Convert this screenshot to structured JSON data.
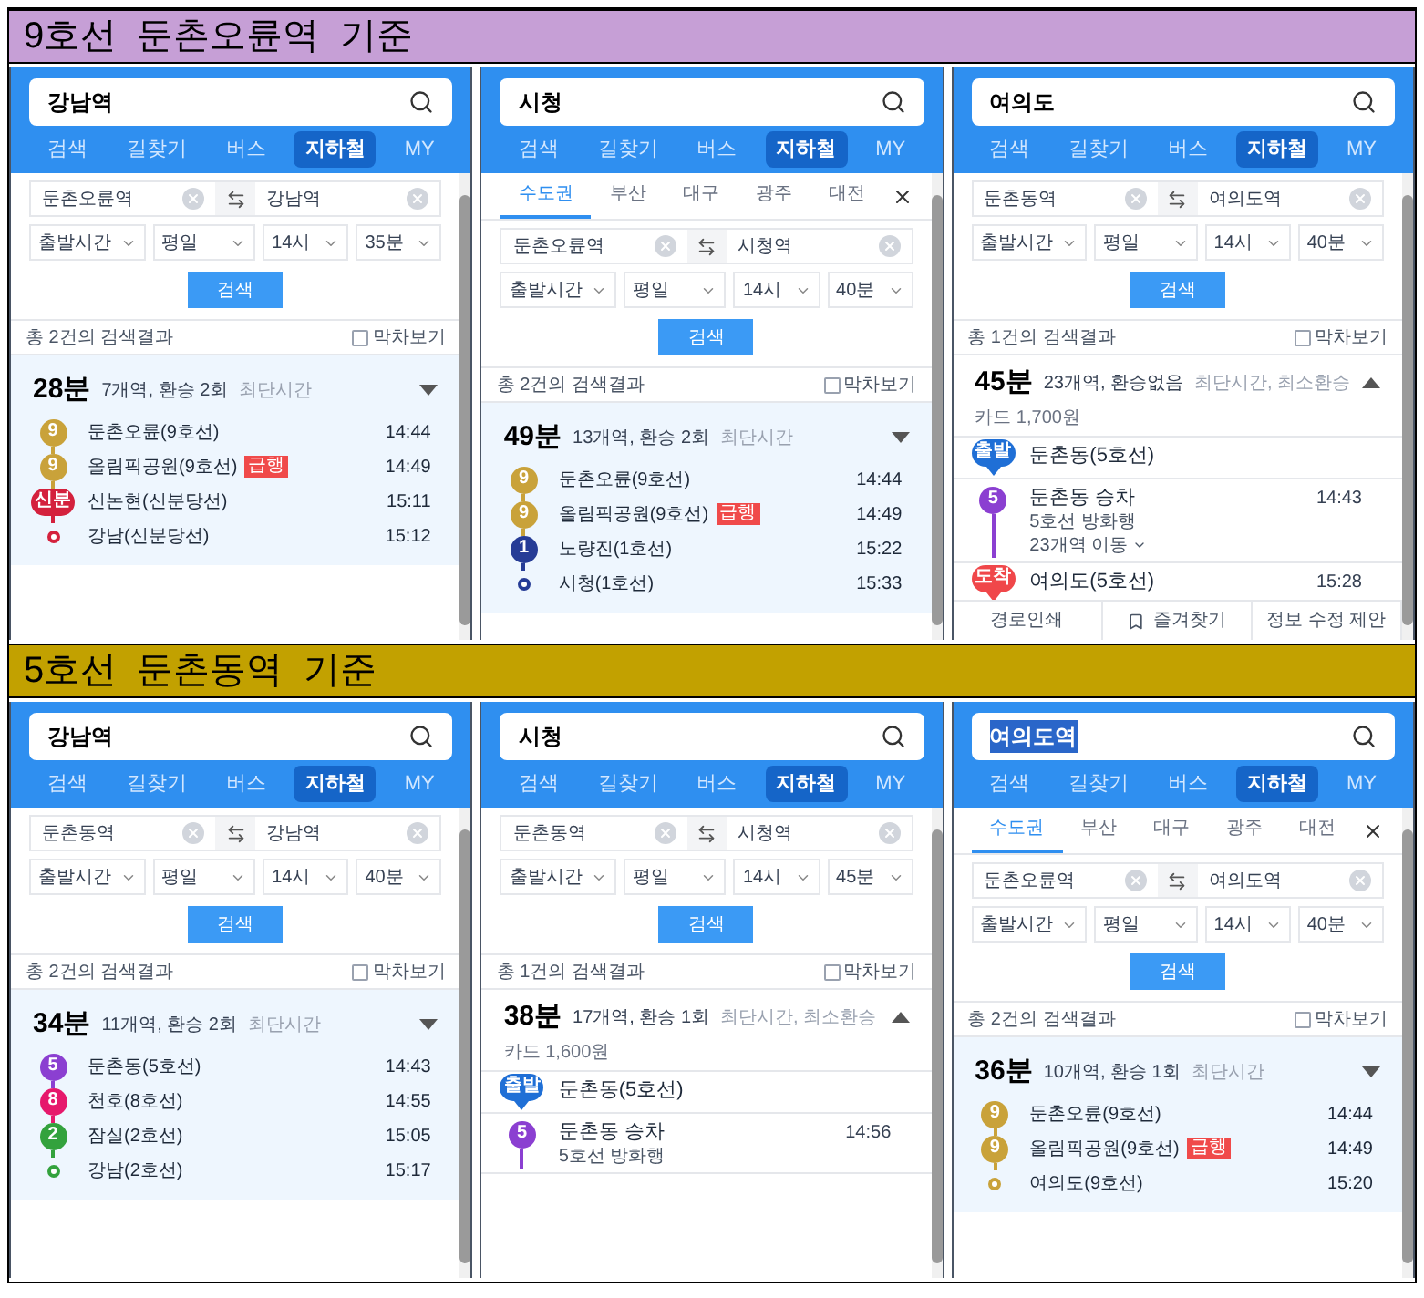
{
  "sections": [
    {
      "title": "9호선  둔촌오륜역  기준",
      "color": "#c69fd6",
      "panels": [
        {
          "query": "강남역",
          "query_highlighted": false,
          "nav_tabs": [
            {
              "label": "검색",
              "selected": false
            },
            {
              "label": "길찾기",
              "selected": false
            },
            {
              "label": "버스",
              "selected": false
            },
            {
              "label": "지하철",
              "selected": true
            },
            {
              "label": "MY",
              "selected": false
            }
          ],
          "from": "둔촌오륜역",
          "to": "강남역",
          "selects": [
            "출발시간",
            "평일",
            "14시",
            "35분"
          ],
          "search_button": "검색",
          "result_count": "총 2건의 검색결과",
          "last_train": {
            "label": "막차보기",
            "checked": false
          },
          "route": {
            "kind": "compact",
            "duration": "28분",
            "summary": "7개역, 환승 2회",
            "tags": "최단시간",
            "expanded": false,
            "stops": [
              {
                "kind": "station",
                "badge": "9",
                "color": "#c9a23a",
                "name": "둔촌오륜(9호선)",
                "time": "14:44"
              },
              {
                "kind": "station",
                "badge": "9",
                "color": "#c9a23a",
                "name": "올림픽공원(9호선)",
                "express": "급행",
                "time": "14:49"
              },
              {
                "kind": "station",
                "badge": "신분",
                "color": "#d4213d",
                "name": "신논현(신분당선)",
                "time": "15:11"
              },
              {
                "kind": "end",
                "color": "#d4213d",
                "name": "강남(신분당선)",
                "time": "15:12"
              }
            ]
          }
        },
        {
          "query": "시청",
          "query_highlighted": false,
          "nav_tabs": [
            {
              "label": "검색",
              "selected": false
            },
            {
              "label": "길찾기",
              "selected": false
            },
            {
              "label": "버스",
              "selected": false
            },
            {
              "label": "지하철",
              "selected": true
            },
            {
              "label": "MY",
              "selected": false
            }
          ],
          "region_tabs": [
            {
              "label": "수도권",
              "selected": true
            },
            {
              "label": "부산",
              "selected": false
            },
            {
              "label": "대구",
              "selected": false
            },
            {
              "label": "광주",
              "selected": false
            },
            {
              "label": "대전",
              "selected": false
            }
          ],
          "from": "둔촌오륜역",
          "to": "시청역",
          "selects": [
            "출발시간",
            "평일",
            "14시",
            "40분"
          ],
          "search_button": "검색",
          "result_count": "총 2건의 검색결과",
          "last_train": {
            "label": "막차보기",
            "checked": false
          },
          "route": {
            "kind": "compact",
            "duration": "49분",
            "summary": "13개역, 환승 2회",
            "tags": "최단시간",
            "expanded": false,
            "stops": [
              {
                "kind": "station",
                "badge": "9",
                "color": "#c9a23a",
                "name": "둔촌오륜(9호선)",
                "time": "14:44"
              },
              {
                "kind": "station",
                "badge": "9",
                "color": "#c9a23a",
                "name": "올림픽공원(9호선)",
                "express": "급행",
                "time": "14:49"
              },
              {
                "kind": "station",
                "badge": "1",
                "color": "#263c96",
                "name": "노량진(1호선)",
                "time": "15:22"
              },
              {
                "kind": "end",
                "color": "#263c96",
                "name": "시청(1호선)",
                "time": "15:33"
              }
            ]
          }
        },
        {
          "query": "여의도",
          "query_highlighted": false,
          "nav_tabs": [
            {
              "label": "검색",
              "selected": false
            },
            {
              "label": "길찾기",
              "selected": false
            },
            {
              "label": "버스",
              "selected": false
            },
            {
              "label": "지하철",
              "selected": true
            },
            {
              "label": "MY",
              "selected": false
            }
          ],
          "from": "둔촌동역",
          "to": "여의도역",
          "selects": [
            "출발시간",
            "평일",
            "14시",
            "40분"
          ],
          "search_button": "검색",
          "result_count": "총 1건의 검색결과",
          "last_train": {
            "label": "막차보기",
            "checked": false
          },
          "route": {
            "kind": "detailed",
            "duration": "45분",
            "summary": "23개역, 환승없음",
            "tags": "최단시간, 최소환승",
            "fare": "카드 1,700원",
            "expanded": true,
            "stops": [
              {
                "kind": "origin",
                "pin": "출발",
                "color": "#1f6fd6",
                "name": "둔촌동(5호선)"
              },
              {
                "kind": "board",
                "badge": "5",
                "color": "#8b3fd1",
                "name": "둔촌동 승차",
                "time": "14:43",
                "direction": "5호선 방화행",
                "more": "23개역 이동"
              },
              {
                "kind": "destination",
                "pin": "도착",
                "color": "#f0474a",
                "name": "여의도(5호선)",
                "time": "15:28"
              }
            ]
          },
          "footer": [
            {
              "label": "경로인쇄",
              "kind": "text"
            },
            {
              "label": "즐겨찾기",
              "kind": "bookmark"
            },
            {
              "label": "정보 수정 제안",
              "kind": "text"
            }
          ]
        }
      ]
    },
    {
      "title": "5호선  둔촌동역  기준",
      "color": "#c2a100",
      "panels": [
        {
          "query": "강남역",
          "query_highlighted": false,
          "nav_tabs": [
            {
              "label": "검색",
              "selected": false
            },
            {
              "label": "길찾기",
              "selected": false
            },
            {
              "label": "버스",
              "selected": false
            },
            {
              "label": "지하철",
              "selected": true
            },
            {
              "label": "MY",
              "selected": false
            }
          ],
          "from": "둔촌동역",
          "to": "강남역",
          "selects": [
            "출발시간",
            "평일",
            "14시",
            "40분"
          ],
          "search_button": "검색",
          "result_count": "총 2건의 검색결과",
          "last_train": {
            "label": "막차보기",
            "checked": false
          },
          "route": {
            "kind": "compact",
            "duration": "34분",
            "summary": "11개역, 환승 2회",
            "tags": "최단시간",
            "expanded": false,
            "stops": [
              {
                "kind": "station",
                "badge": "5",
                "color": "#8b3fd1",
                "name": "둔촌동(5호선)",
                "time": "14:43"
              },
              {
                "kind": "station",
                "badge": "8",
                "color": "#e6186c",
                "name": "천호(8호선)",
                "time": "14:55"
              },
              {
                "kind": "station",
                "badge": "2",
                "color": "#33a23d",
                "name": "잠실(2호선)",
                "time": "15:05"
              },
              {
                "kind": "end",
                "color": "#33a23d",
                "name": "강남(2호선)",
                "time": "15:17"
              }
            ]
          }
        },
        {
          "query": "시청",
          "query_highlighted": false,
          "nav_tabs": [
            {
              "label": "검색",
              "selected": false
            },
            {
              "label": "길찾기",
              "selected": false
            },
            {
              "label": "버스",
              "selected": false
            },
            {
              "label": "지하철",
              "selected": true
            },
            {
              "label": "MY",
              "selected": false
            }
          ],
          "from": "둔촌동역",
          "to": "시청역",
          "selects": [
            "출발시간",
            "평일",
            "14시",
            "45분"
          ],
          "search_button": "검색",
          "result_count": "총 1건의 검색결과",
          "last_train": {
            "label": "막차보기",
            "checked": false
          },
          "route": {
            "kind": "detailed",
            "duration": "38분",
            "summary": "17개역, 환승 1회",
            "tags": "최단시간, 최소환승",
            "fare": "카드 1,600원",
            "expanded": true,
            "stops": [
              {
                "kind": "origin",
                "pin": "출발",
                "color": "#1f6fd6",
                "name": "둔촌동(5호선)"
              },
              {
                "kind": "board",
                "badge": "5",
                "color": "#8b3fd1",
                "name": "둔촌동 승차",
                "time": "14:56",
                "direction": "5호선 방화행"
              }
            ]
          }
        },
        {
          "query": "여의도역",
          "query_highlighted": true,
          "nav_tabs": [
            {
              "label": "검색",
              "selected": false
            },
            {
              "label": "길찾기",
              "selected": false
            },
            {
              "label": "버스",
              "selected": false
            },
            {
              "label": "지하철",
              "selected": true
            },
            {
              "label": "MY",
              "selected": false
            }
          ],
          "region_tabs": [
            {
              "label": "수도권",
              "selected": true
            },
            {
              "label": "부산",
              "selected": false
            },
            {
              "label": "대구",
              "selected": false
            },
            {
              "label": "광주",
              "selected": false
            },
            {
              "label": "대전",
              "selected": false
            }
          ],
          "from": "둔촌오륜역",
          "to": "여의도역",
          "selects": [
            "출발시간",
            "평일",
            "14시",
            "40분"
          ],
          "search_button": "검색",
          "result_count": "총 2건의 검색결과",
          "last_train": {
            "label": "막차보기",
            "checked": false
          },
          "route": {
            "kind": "compact",
            "duration": "36분",
            "summary": "10개역, 환승 1회",
            "tags": "최단시간",
            "expanded": false,
            "stops": [
              {
                "kind": "station",
                "badge": "9",
                "color": "#c9a23a",
                "name": "둔촌오륜(9호선)",
                "time": "14:44"
              },
              {
                "kind": "station",
                "badge": "9",
                "color": "#c9a23a",
                "name": "올림픽공원(9호선)",
                "express": "급행",
                "time": "14:49"
              },
              {
                "kind": "end",
                "color": "#c9a23a",
                "name": "여의도(9호선)",
                "time": "15:20"
              }
            ]
          }
        }
      ]
    }
  ]
}
